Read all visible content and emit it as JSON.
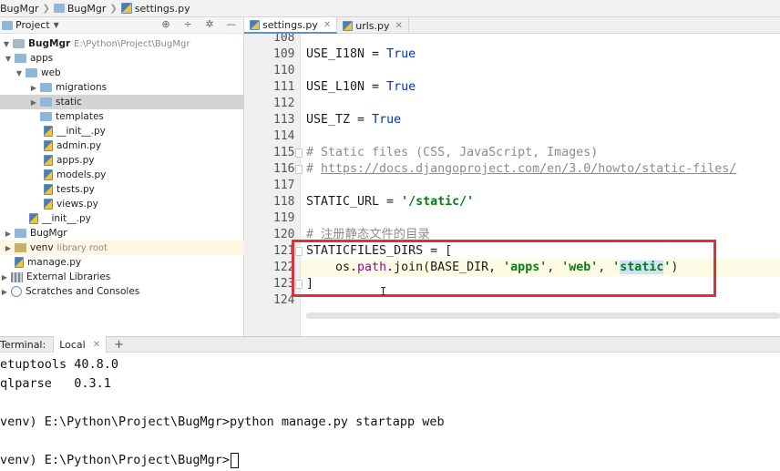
{
  "breadcrumb": [
    "BugMgr",
    "BugMgr",
    "settings.py"
  ],
  "project_panel": {
    "title": "Project",
    "tree": [
      {
        "label": "BugMgr",
        "extra": "E:\\Python\\Project\\BugMgr",
        "type": "folder"
      },
      {
        "label": "apps",
        "type": "folder"
      },
      {
        "label": "web",
        "type": "folder"
      },
      {
        "label": "migrations",
        "type": "folder"
      },
      {
        "label": "static",
        "type": "folder"
      },
      {
        "label": "templates",
        "type": "folder"
      },
      {
        "label": "__init__.py",
        "type": "py"
      },
      {
        "label": "admin.py",
        "type": "py"
      },
      {
        "label": "apps.py",
        "type": "py"
      },
      {
        "label": "models.py",
        "type": "py"
      },
      {
        "label": "tests.py",
        "type": "py"
      },
      {
        "label": "views.py",
        "type": "py"
      },
      {
        "label": "__init__.py",
        "type": "py"
      },
      {
        "label": "BugMgr",
        "type": "folder"
      },
      {
        "label": "venv",
        "extra": "library root",
        "type": "folder"
      },
      {
        "label": "manage.py",
        "type": "py"
      },
      {
        "label": "External Libraries",
        "type": "lib"
      },
      {
        "label": "Scratches and Consoles",
        "type": "scratch"
      }
    ]
  },
  "editor": {
    "tabs": [
      {
        "label": "settings.py",
        "active": true
      },
      {
        "label": "urls.py",
        "active": false
      }
    ],
    "line_numbers": [
      "108",
      "109",
      "110",
      "111",
      "112",
      "113",
      "114",
      "115",
      "116",
      "117",
      "118",
      "119",
      "120",
      "121",
      "122",
      "123",
      "124"
    ],
    "code": {
      "l109_a": "USE_I18N",
      "l109_b": " = ",
      "l109_c": "True",
      "l111_a": "USE_L10N",
      "l111_b": " = ",
      "l111_c": "True",
      "l113_a": "USE_TZ",
      "l113_b": " = ",
      "l113_c": "True",
      "l115": "# Static files (CSS, JavaScript, Images)",
      "l116_a": "# ",
      "l116_b": "https://docs.djangoproject.com/en/3.0/howto/static-files/",
      "l118_a": "STATIC_URL = ",
      "l118_b": "'/static/'",
      "l120": "# 注册静态文件的目录",
      "l121": "STATICFILES_DIRS = [",
      "l122_a": "    os.",
      "l122_b": "path",
      "l122_c": ".join(BASE_DIR, ",
      "l122_d": "'apps'",
      "l122_e": ", ",
      "l122_f": "'web'",
      "l122_g": ", ",
      "l122_h": "'",
      "l122_i": "static",
      "l122_j": "'",
      "l122_k": ")",
      "l123": "]"
    }
  },
  "terminal": {
    "label": "Terminal:",
    "tab": "Local",
    "add": "+",
    "lines": [
      "etuptools 40.8.0",
      "qlparse   0.3.1",
      "",
      "venv) E:\\Python\\Project\\BugMgr>python manage.py startapp web",
      "",
      "venv) E:\\Python\\Project\\BugMgr>"
    ]
  },
  "colors": {
    "highlight_box": "#d6333a",
    "keyword": "#0033b3",
    "string": "#067d17",
    "comment": "#8c8c8c",
    "selection": "#d4d4d4"
  }
}
